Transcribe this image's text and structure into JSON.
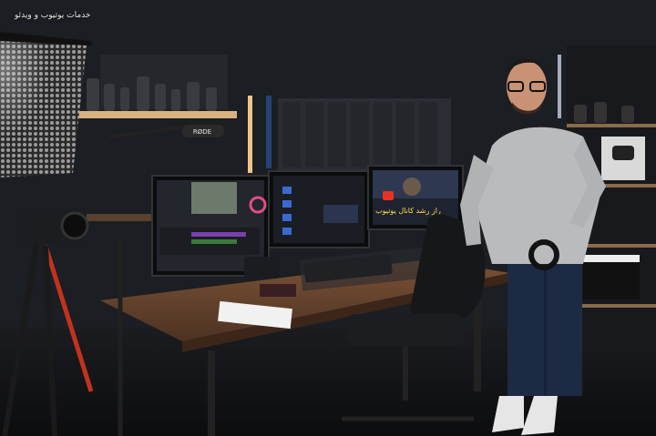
{
  "caption": "خدمات یوتیوب و ویدئو",
  "brand_label": "RØDE",
  "right_monitor_title": "راز رشد کانال یوتیوب",
  "colors": {
    "wall": "#1b1e22",
    "acoustic": "#2a2d33",
    "desk": "#6b4630",
    "shirt": "#b9bbbd",
    "jeans": "#1c2a44",
    "accent_red": "#d63a2f"
  }
}
